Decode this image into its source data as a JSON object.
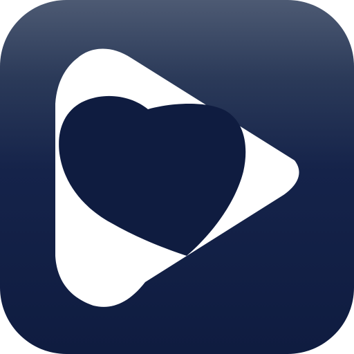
{
  "app_icon": {
    "glyph": "play-heart-icon",
    "colors": {
      "tile_top": "#4d5a73",
      "tile_bottom": "#0f1c40",
      "play_shape": "#ffffff",
      "heart": "#0f1c40"
    }
  }
}
